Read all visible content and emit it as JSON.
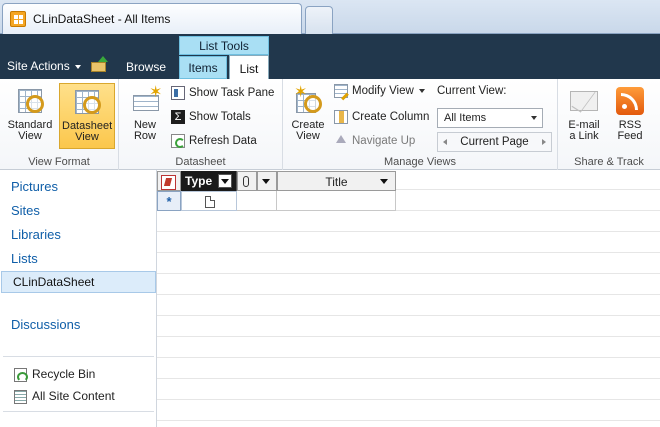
{
  "browser": {
    "tab_title": "CLinDataSheet - All Items",
    "favicon_icon": "sharepoint-list-icon"
  },
  "topbar": {
    "site_actions": "Site Actions",
    "tabs": {
      "browse": "Browse",
      "items": "Items",
      "list": "List"
    },
    "context_group": "List Tools",
    "active_tab": "List"
  },
  "ribbon": {
    "groups": {
      "view_format": "View Format",
      "datasheet": "Datasheet",
      "manage_views": "Manage Views",
      "share_track": "Share & Track"
    },
    "view_format": {
      "standard_view": "Standard View",
      "datasheet_view": "Datasheet View"
    },
    "datasheet": {
      "new_row": "New Row",
      "show_task_pane": "Show Task Pane",
      "show_totals": "Show Totals",
      "refresh_data": "Refresh Data"
    },
    "manage_views": {
      "create_view": "Create View",
      "modify_view": "Modify View",
      "create_column": "Create Column",
      "navigate_up": "Navigate Up",
      "current_view_label": "Current View:",
      "current_view_value": "All Items",
      "current_page": "Current Page"
    },
    "share_track": {
      "email_link": "E-mail a Link",
      "rss_feed": "RSS Feed"
    }
  },
  "leftnav": {
    "links": [
      "Pictures",
      "Sites",
      "Libraries",
      "Lists"
    ],
    "selected": "CLinDataSheet",
    "discussions": "Discussions",
    "recycle_bin": "Recycle Bin",
    "all_site_content": "All Site Content"
  },
  "datasheet": {
    "columns": [
      "Type",
      "Title"
    ],
    "new_row_marker": "*"
  }
}
